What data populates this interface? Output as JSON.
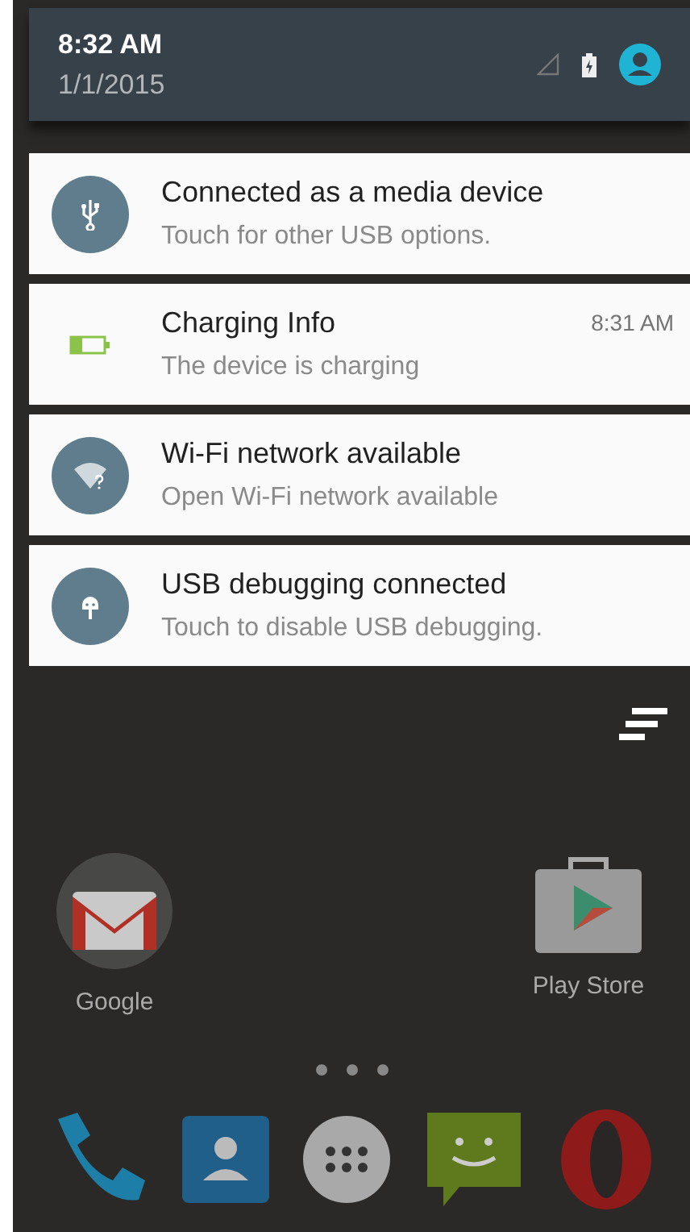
{
  "status_header": {
    "time": "8:32 AM",
    "date": "1/1/2015"
  },
  "notifications": [
    {
      "kind": "usb",
      "title": "Connected as a media device",
      "text": "Touch for other USB options."
    },
    {
      "kind": "battery",
      "title": "Charging Info",
      "text": "The device is charging",
      "time": "8:31 AM"
    },
    {
      "kind": "wifi",
      "title": "Wi-Fi network available",
      "text": "Open Wi-Fi network available"
    },
    {
      "kind": "debug",
      "title": "USB debugging connected",
      "text": "Touch to disable USB debugging."
    }
  ],
  "home_apps": [
    {
      "kind": "mail",
      "label": "Google"
    },
    {
      "kind": "store",
      "label": "Play Store"
    }
  ],
  "dock": [
    {
      "kind": "phone"
    },
    {
      "kind": "contacts"
    },
    {
      "kind": "apps"
    },
    {
      "kind": "messages"
    },
    {
      "kind": "browser"
    }
  ]
}
